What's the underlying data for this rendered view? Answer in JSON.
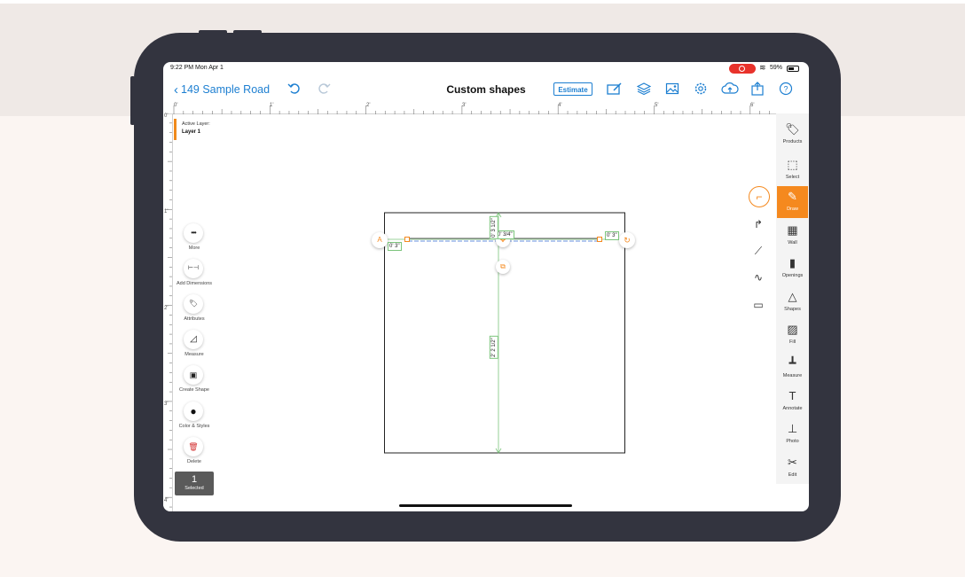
{
  "status_bar": {
    "time": "9:22 PM  Mon Apr 1",
    "battery": "59%"
  },
  "nav": {
    "back_label": "149 Sample Road",
    "title": "Custom shapes",
    "estimate_label": "Estimate"
  },
  "rulers": {
    "top_labels": [
      "0'",
      "1'",
      "2'",
      "3'",
      "4'",
      "5'",
      "6'"
    ],
    "left_labels": [
      "0'",
      "1'",
      "2'",
      "3'",
      "4'"
    ]
  },
  "active_layer": {
    "caption": "Active Layer:",
    "name": "Layer 1"
  },
  "left_tools": [
    {
      "label": "More",
      "icon": "more-icon",
      "glyph": "•••"
    },
    {
      "label": "Add Dimensions",
      "icon": "dimension-icon",
      "glyph": "⊢⊣"
    },
    {
      "label": "Attributes",
      "icon": "tag-icon",
      "glyph": "🏷"
    },
    {
      "label": "Measure",
      "icon": "triangle-ruler-icon",
      "glyph": "◿"
    },
    {
      "label": "Create Shape",
      "icon": "create-shape-icon",
      "glyph": "▣"
    },
    {
      "label": "Color & Styles",
      "icon": "color-styles-icon",
      "glyph": "●"
    },
    {
      "label": "Delete",
      "icon": "trash-icon",
      "glyph": "🗑"
    }
  ],
  "selection": {
    "count": "1",
    "label": "Selected"
  },
  "right_tools": [
    {
      "label": "Products",
      "icon": "products-tag-icon",
      "glyph": "🏷"
    },
    {
      "label": "Select",
      "icon": "select-marquee-icon",
      "glyph": "⬚"
    },
    {
      "label": "Draw",
      "icon": "draw-pen-icon",
      "glyph": "✎",
      "active": true
    },
    {
      "label": "Wall",
      "icon": "wall-brick-icon",
      "glyph": "▦"
    },
    {
      "label": "Openings",
      "icon": "door-icon",
      "glyph": "▮"
    },
    {
      "label": "Shapes",
      "icon": "shapes-icon",
      "glyph": "△"
    },
    {
      "label": "Fill",
      "icon": "fill-hatch-icon",
      "glyph": "▨"
    },
    {
      "label": "Measure",
      "icon": "measure-icon",
      "glyph": "┻"
    },
    {
      "label": "Annotate",
      "icon": "text-annotate-icon",
      "glyph": "T"
    },
    {
      "label": "Photo",
      "icon": "camera-tripod-icon",
      "glyph": "⊥"
    },
    {
      "label": "Edit",
      "icon": "scissors-icon",
      "glyph": "✂"
    }
  ],
  "draw_subtools": [
    {
      "icon": "polyline-icon",
      "glyph": "⌐"
    },
    {
      "icon": "corner-line-icon",
      "glyph": "↱"
    },
    {
      "icon": "angle-line-icon",
      "glyph": "⟋"
    },
    {
      "icon": "curve-icon",
      "glyph": "∿"
    },
    {
      "icon": "rectangle-icon",
      "glyph": "▭"
    }
  ],
  "dimensions": {
    "left_tag": "0' 3\"",
    "right_tag": "0' 3\"",
    "top_center": "0' 3/4\"",
    "upper_vertical": "0' 3 1/2\"",
    "main_vertical": "2' 2 1/2\""
  }
}
